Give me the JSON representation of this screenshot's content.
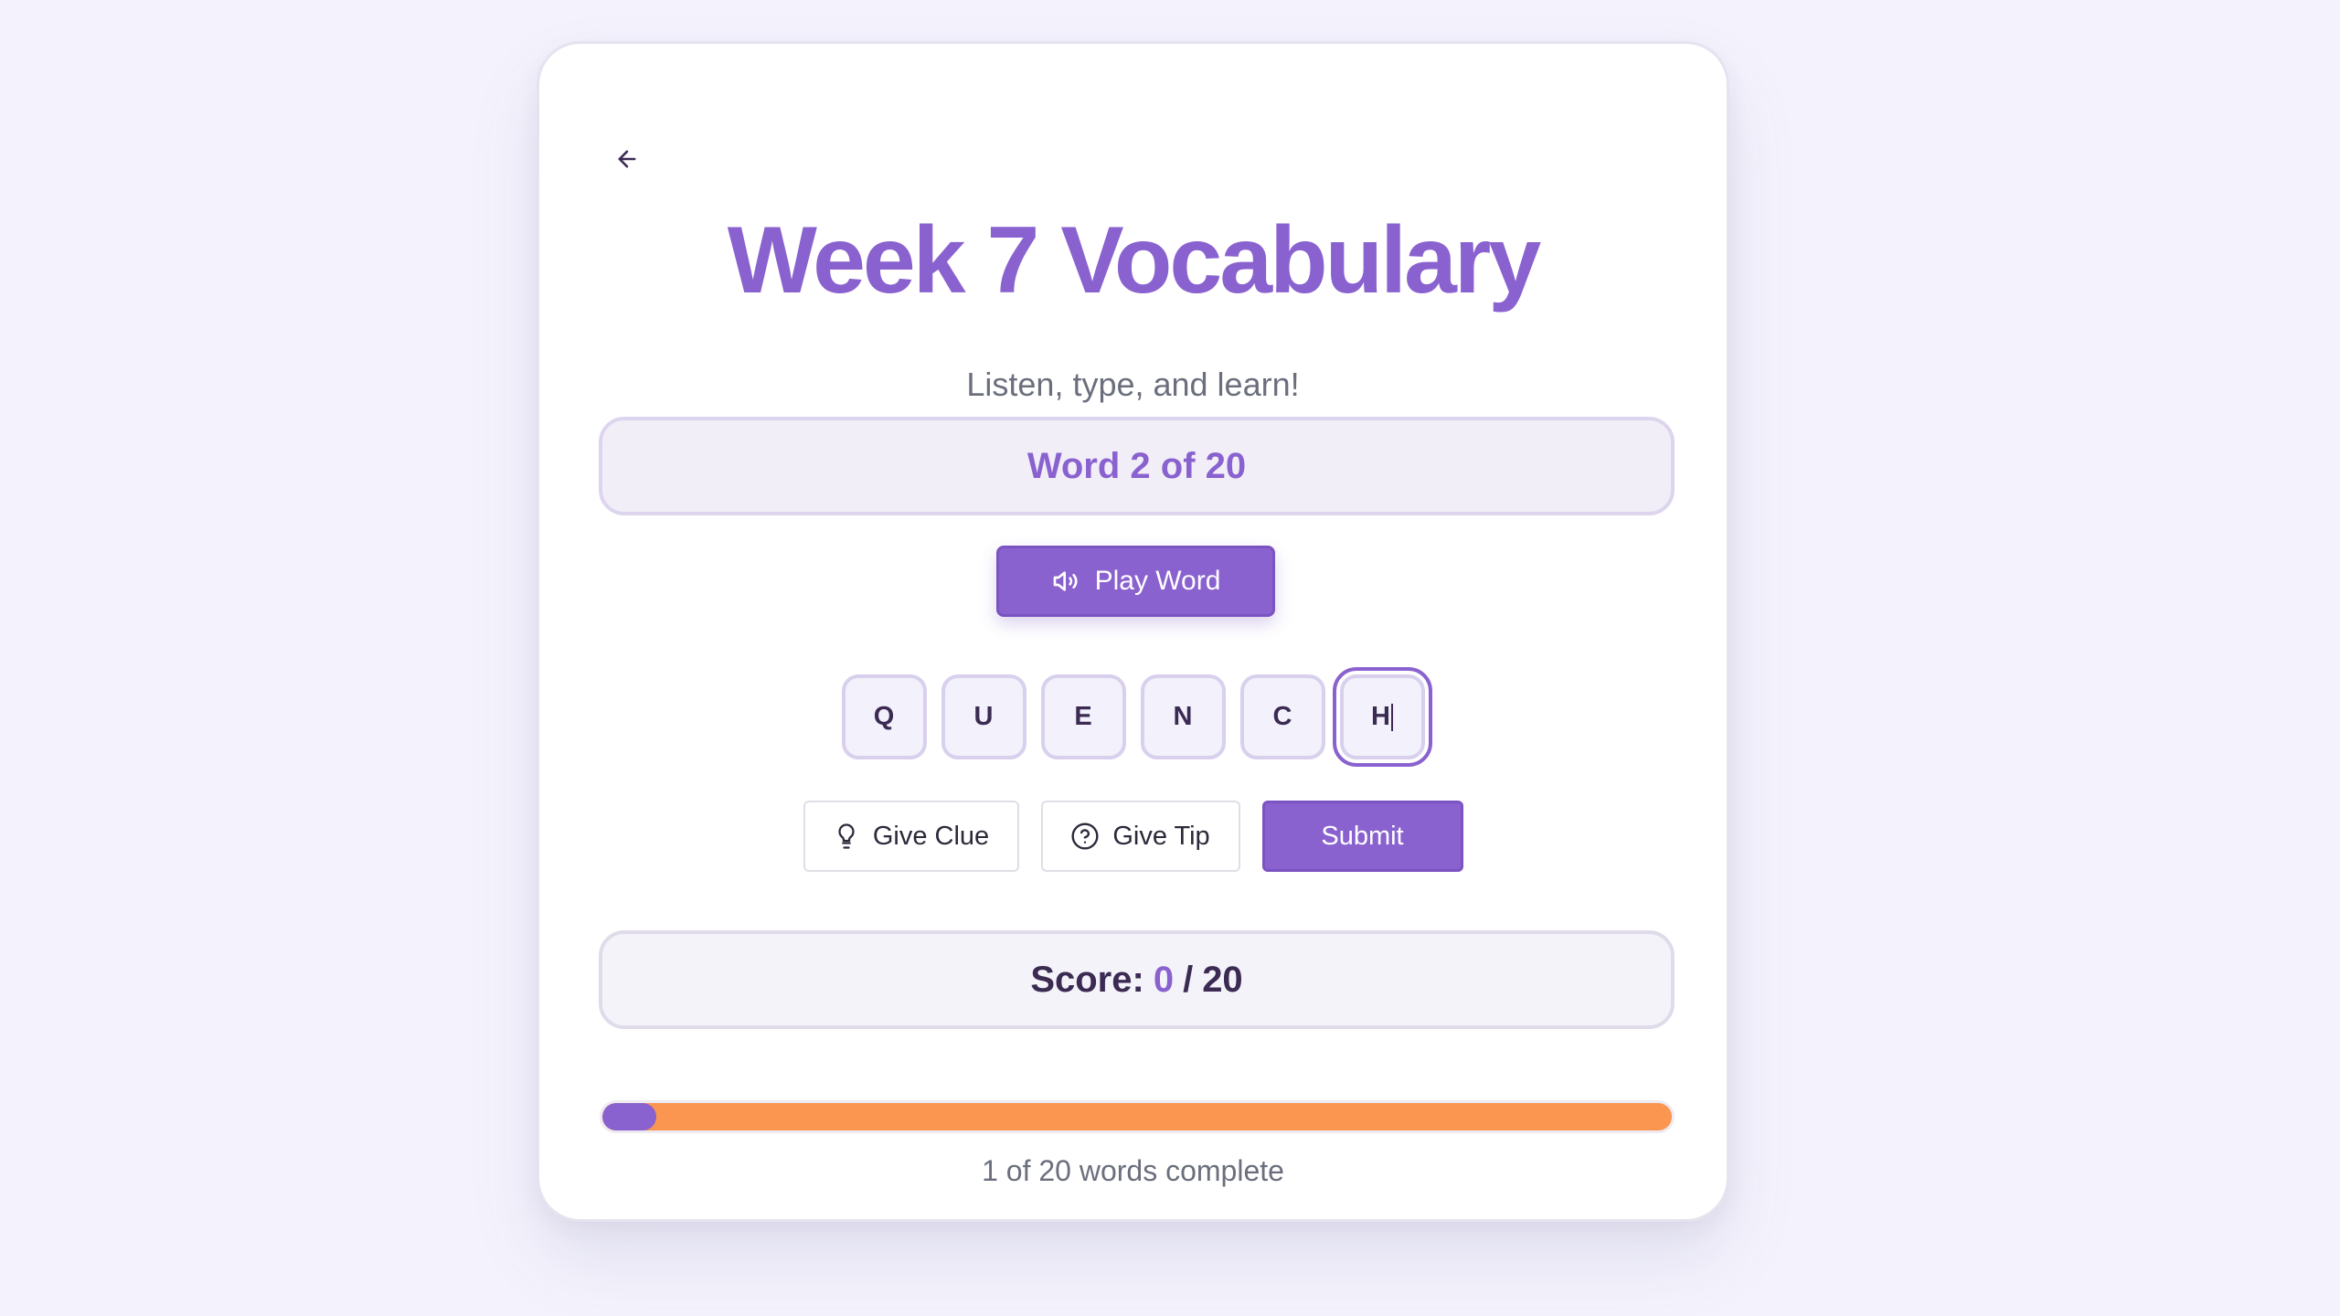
{
  "header": {
    "back_icon": "arrow-left-icon",
    "title": "Week 7 Vocabulary",
    "subtitle": "Listen, type, and learn!"
  },
  "word_counter": {
    "text": "Word 2 of 20"
  },
  "play_button": {
    "icon": "speaker-icon",
    "label": "Play Word"
  },
  "letter_tiles": [
    "Q",
    "U",
    "E",
    "N",
    "C",
    "H"
  ],
  "active_tile_index": 5,
  "actions": {
    "clue_icon": "lightbulb-icon",
    "clue_label": "Give Clue",
    "tip_icon": "help-circle-icon",
    "tip_label": "Give Tip",
    "submit_label": "Submit"
  },
  "score": {
    "label": "Score:",
    "value": "0",
    "separator": "/",
    "total": "20"
  },
  "progress": {
    "completed": 1,
    "total": 20,
    "text": "1 of 20 words complete"
  },
  "colors": {
    "accent": "#8a62cf",
    "progress_remaining": "#fa9650",
    "background": "#f4f3fd",
    "text_dark": "#3b2b52",
    "text_muted": "#6b6f7d"
  }
}
